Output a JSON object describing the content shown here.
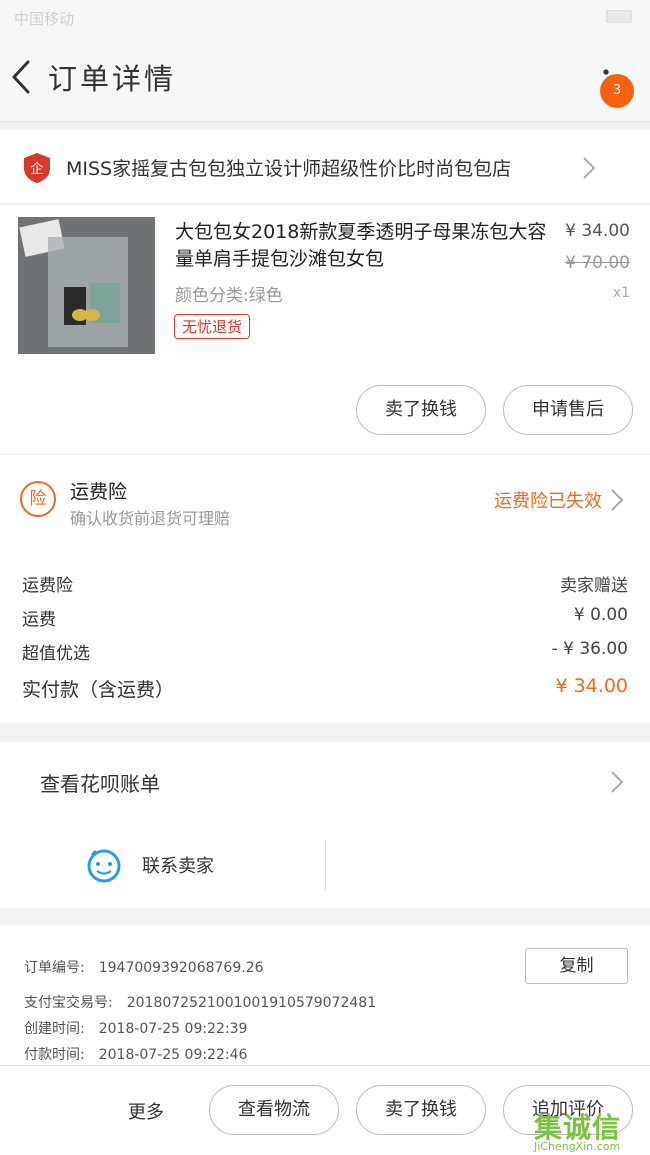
{
  "statusbar": {
    "carrier": "中国移动",
    "signal_extra": "•••"
  },
  "navbar": {
    "title": "订单详情",
    "badge": "3"
  },
  "shop": {
    "name": "MISS家摇复古包包独立设计师超级性价比时尚包包店"
  },
  "product": {
    "title": "大包包女2018新款夏季透明子母果冻包大容量单肩手提包沙滩包女包",
    "variant": "颜色分类:绿色",
    "tag": "无忧退货",
    "price": "¥ 34.00",
    "old_price": "¥ 70.00",
    "quantity": "x1",
    "buttons": {
      "return": "卖了换钱",
      "after_sales": "申请售后"
    }
  },
  "insurance": {
    "icon_label": "险",
    "title": "运费险",
    "subtitle": "确认收货前退货可理赔",
    "status": "运费险已失效"
  },
  "fees": [
    {
      "label": "运费险",
      "value": "卖家赠送"
    },
    {
      "label": "运费",
      "value": "¥ 0.00"
    },
    {
      "label": "超值优选",
      "value": "- ¥ 36.00"
    }
  ],
  "total": {
    "label": "实付款（含运费）",
    "value": "¥ 34.00"
  },
  "huabei": {
    "label": "查看花呗账单"
  },
  "contact": {
    "label": "联系卖家"
  },
  "order_info": {
    "order_no_label": "订单编号:",
    "order_no": "1947009392068769.26",
    "alipay_label": "支付宝交易号:",
    "alipay_no": "2018072521001001910579072481",
    "created_label": "创建时间:",
    "created": "2018-07-25  09:22:39",
    "paid_label": "付款时间:",
    "paid": "2018-07-25  09:22:46",
    "copy_label": "复制"
  },
  "bottombar": {
    "more": "更多",
    "logistics": "查看物流",
    "sell": "卖了换钱",
    "review": "追加评价"
  },
  "watermark": {
    "text": "集诚信",
    "url": "JiChengXin.com"
  },
  "colors": {
    "accent": "#f06a1e",
    "badge": "#f5620e",
    "tag_red": "#d9392a"
  }
}
